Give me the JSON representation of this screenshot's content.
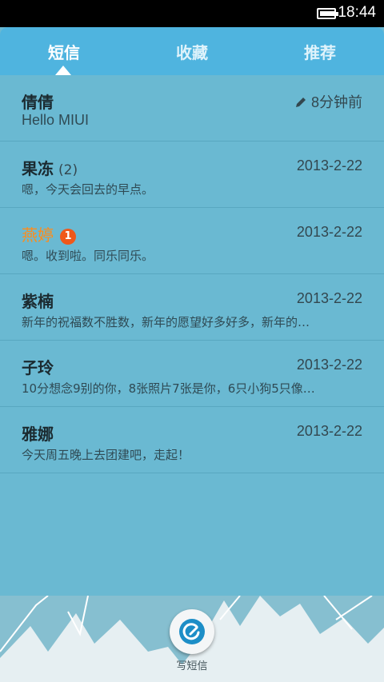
{
  "status_bar": {
    "time": "18:44",
    "battery_level": 0.9
  },
  "tabs": [
    {
      "label": "短信",
      "active": true
    },
    {
      "label": "收藏",
      "active": false
    },
    {
      "label": "推荐",
      "active": false
    }
  ],
  "conversations": [
    {
      "name": "倩倩",
      "preview": "Hello MIUI",
      "time": "8分钟前",
      "draft": true
    },
    {
      "name": "果冻",
      "count": "(2)",
      "preview": "嗯，今天会回去的早点。",
      "time": "2013-2-22"
    },
    {
      "name": "燕婷",
      "unread": "1",
      "preview": "嗯。收到啦。同乐同乐。",
      "time": "2013-2-22"
    },
    {
      "name": "紫楠",
      "preview": "新年的祝福数不胜数，新年的愿望好多好多，新年的…",
      "time": "2013-2-22"
    },
    {
      "name": "子玲",
      "preview": "10分想念9别的你，8张照片7张是你，6只小狗5只像…",
      "time": "2013-2-22"
    },
    {
      "name": "雅娜",
      "preview": "今天周五晚上去团建吧，走起！",
      "time": "2013-2-22"
    }
  ],
  "compose": {
    "label": "写短信",
    "icon": "compose-icon"
  },
  "colors": {
    "tab_bar": "#4fb4df",
    "list_bg": "#6ab9d2",
    "unread_name": "#ff8c1a",
    "badge": "#f0581a",
    "compose_icon": "#1d8ec7"
  }
}
